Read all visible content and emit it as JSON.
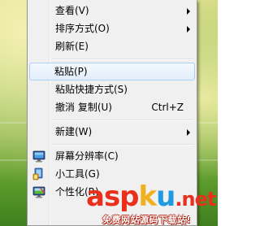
{
  "menu": {
    "items": [
      {
        "label": "查看(V)",
        "submenu": true
      },
      {
        "label": "排序方式(O)",
        "submenu": true
      },
      {
        "label": "刷新(E)"
      },
      {
        "label": "粘贴(P)"
      },
      {
        "label": "粘贴快捷方式(S)"
      },
      {
        "label": "撤消 复制(U)",
        "shortcut": "Ctrl+Z"
      },
      {
        "label": "新建(W)",
        "submenu": true
      },
      {
        "label": "屏幕分辨率(C)",
        "icon": "screen-resolution-icon"
      },
      {
        "label": "小工具(G)",
        "icon": "gadgets-icon"
      },
      {
        "label": "个性化(R)",
        "icon": "personalize-icon"
      }
    ],
    "highlighted_label": "粘贴(P)"
  },
  "watermark": {
    "logo_a": "asp",
    "logo_b": "k",
    "logo_c": "u",
    "logo_d": ".net",
    "subtitle": "免费网站源码下载站!"
  }
}
